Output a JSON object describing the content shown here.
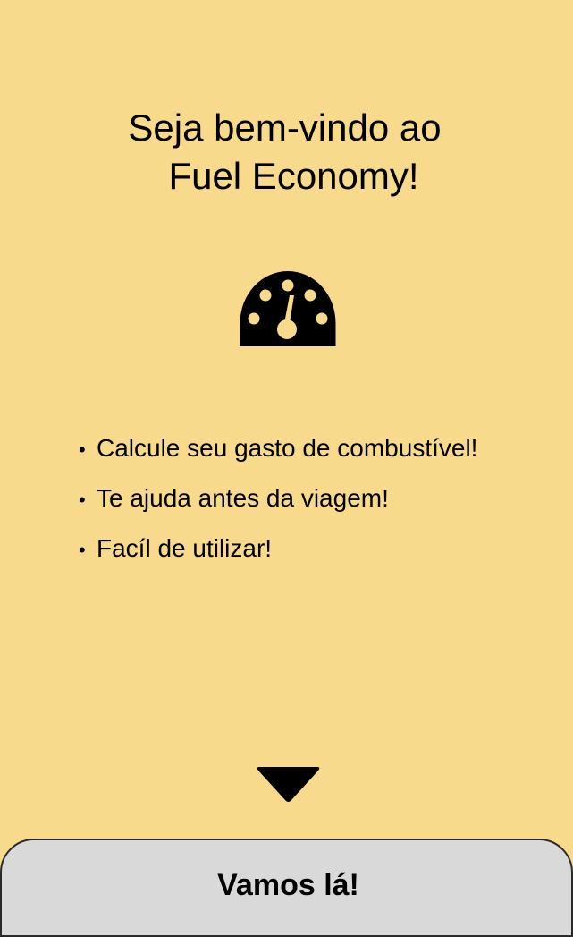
{
  "welcome": {
    "title_line1": "Seja bem-vindo ao",
    "title_line2": "Fuel Economy!"
  },
  "icon": {
    "gauge": "speedometer-icon",
    "scroll": "triangle-down-icon"
  },
  "features": {
    "items": [
      "Calcule seu gasto de combustível!",
      "Te ajuda antes da viagem!",
      "Facíl de utilizar!"
    ],
    "bullet": "•"
  },
  "actions": {
    "start_label": "Vamos lá!"
  },
  "colors": {
    "background": "#f7da8c",
    "button": "#d9d9d9",
    "icon": "#000000"
  }
}
